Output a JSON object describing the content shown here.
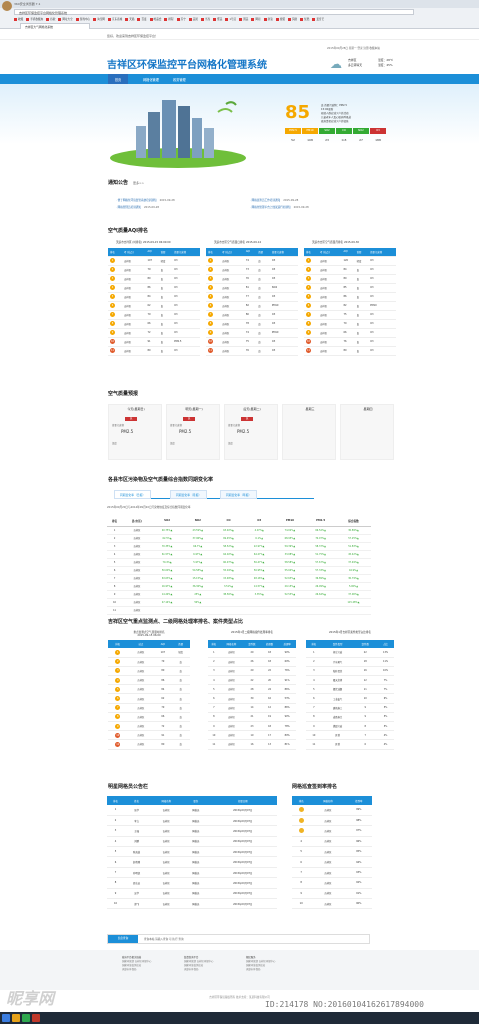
{
  "browser": {
    "window_title": "360安全浏览器 7.1",
    "address": "吉祥区环保监控平台网格化管理系统",
    "tab": "吉祥区大气网格化系统",
    "favs": [
      "收藏",
      "手机收藏夹",
      "谷歌",
      "网址大全",
      "游戏中心",
      "淘宝网",
      "京东商城",
      "天猫",
      "百度",
      "唯品会",
      "携程",
      "苏宁",
      "美团",
      "当当",
      "聚美",
      "1号店",
      "国美",
      "网易",
      "新浪",
      "搜狐",
      "凤凰",
      "优酷",
      "爱奇艺"
    ]
  },
  "site": {
    "topbar": "您好，欢迎来到吉祥区环保监控平台！",
    "logo": "吉祥区环保监控平台网格化管理系统",
    "toplinks": "2015年09月28日 星期一  登录  注册  收藏本站",
    "weather": {
      "city": "吉祥区",
      "desc": "多云转晴天",
      "wind": "东北风3级",
      "temp_label": "温度：",
      "temp": "28℃",
      "hum_label": "湿度：",
      "hum": "45%"
    },
    "nav": [
      "首页",
      "网格化管理",
      "政务管理"
    ],
    "aqi": {
      "value": "85",
      "level": "良 首要污染物：PM2.5",
      "time": "15:00更新",
      "line1": "易感人群应减少户外活动",
      "line2": "儿童老年人及心脏病呼吸道",
      "line3": "疾病患者应减少户外锻炼",
      "pollutants": [
        "PM2.5",
        "PM10",
        "SO2",
        "CO",
        "NO2",
        "O3"
      ],
      "values": [
        "52",
        "108",
        "23",
        "0.8",
        "27",
        "188"
      ],
      "colors": [
        "#f5a800",
        "#f5a800",
        "#3a3",
        "#3a3",
        "#3a3",
        "#c33"
      ]
    }
  },
  "notices": {
    "title": "通知公告",
    "more": "更多>>",
    "items": [
      {
        "t": "便于网格化环境监管系统培训通知",
        "d": "2015-09-28"
      },
      {
        "t": "网格巡查员工作培训通知",
        "d": "2015-09-28"
      },
      {
        "t": "网格管理员培训通知",
        "d": "2015-09-28"
      },
      {
        "t": "网格化管理平台上线试运行的通知",
        "d": "2015-09-28"
      }
    ]
  },
  "aqi_rank": {
    "title": "空气质量AQI排名",
    "tables": [
      {
        "caption": "天庭市吉祥区 (时排名) 2015-09-15 06:00:00",
        "head": [
          "排名",
          "考 (站点)",
          "AQI",
          "首要",
          "首要污染物"
        ],
        "rows": [
          [
            "1",
            "吉祥区",
            "107",
            "轻度",
            "O3"
          ],
          [
            "2",
            "吉祥区",
            "79",
            "良",
            "O3"
          ],
          [
            "3",
            "吉祥区",
            "80",
            "良",
            "O3"
          ],
          [
            "4",
            "吉祥区",
            "86",
            "良",
            "O3"
          ],
          [
            "5",
            "吉祥区",
            "84",
            "良",
            "O3"
          ],
          [
            "6",
            "吉祥区",
            "62",
            "良",
            "O3"
          ],
          [
            "7",
            "吉祥区",
            "79",
            "良",
            "O3"
          ],
          [
            "8",
            "吉祥区",
            "66",
            "良",
            "O3"
          ],
          [
            "9",
            "吉祥区",
            "72",
            "良",
            "O3"
          ],
          [
            "10",
            "吉祥区",
            "91",
            "良",
            "PM2.5"
          ],
          [
            "11",
            "吉祥区",
            "80",
            "良",
            "O3"
          ]
        ]
      },
      {
        "caption": "天庭市吉区空气质量日排名 2015-09-14",
        "head": [
          "排名",
          "考 (站点)",
          "AQI",
          "首要",
          "首要污染物"
        ],
        "rows": [
          [
            "1",
            "吉祥区",
            "74",
            "良",
            "O3"
          ],
          [
            "2",
            "吉祥区",
            "73",
            "良",
            "O3"
          ],
          [
            "3",
            "吉祥区",
            "76",
            "良",
            "O3"
          ],
          [
            "4",
            "吉祥区",
            "81",
            "良",
            "NO2"
          ],
          [
            "5",
            "吉祥区",
            "77",
            "良",
            "O3"
          ],
          [
            "6",
            "吉祥区",
            "82",
            "良",
            "PM10"
          ],
          [
            "7",
            "吉祥区",
            "80",
            "良",
            "O3"
          ],
          [
            "8",
            "吉祥区",
            "78",
            "良",
            "O3"
          ],
          [
            "9",
            "吉祥区",
            "74",
            "良",
            "PM10"
          ],
          [
            "10",
            "吉祥区",
            "75",
            "良",
            "O3"
          ],
          [
            "11",
            "吉祥区",
            "76",
            "良",
            "O3"
          ]
        ]
      },
      {
        "caption": "天庭市吉区空气质量月排名 2015-09-30",
        "head": [
          "排名",
          "考 (站点)",
          "AQI",
          "首要",
          "首要污染物"
        ],
        "rows": [
          [
            "1",
            "吉祥区",
            "120",
            "轻度",
            "O3"
          ],
          [
            "2",
            "吉祥区",
            "84",
            "良",
            "O3"
          ],
          [
            "3",
            "吉祥区",
            "80",
            "良",
            "O3"
          ],
          [
            "4",
            "吉祥区",
            "85",
            "良",
            "O3"
          ],
          [
            "5",
            "吉祥区",
            "86",
            "良",
            "O3"
          ],
          [
            "6",
            "吉祥区",
            "82",
            "良",
            "PM10"
          ],
          [
            "7",
            "吉祥区",
            "75",
            "良",
            "O3"
          ],
          [
            "8",
            "吉祥区",
            "70",
            "良",
            "O3"
          ],
          [
            "9",
            "吉祥区",
            "66",
            "良",
            "O3"
          ],
          [
            "10",
            "吉祥区",
            "76",
            "良",
            "O3"
          ],
          [
            "11",
            "吉祥区",
            "80",
            "良",
            "O3"
          ]
        ]
      }
    ]
  },
  "forecast": {
    "title": "空气质量预报",
    "days": [
      {
        "h": "今天(星期日)",
        "tag": "良"
      },
      {
        "h": "明天(星期一)",
        "tag": "良"
      },
      {
        "h": "后天(星期二)",
        "tag": "良"
      },
      {
        "h": "星期三",
        "tag": ""
      },
      {
        "h": "星期四",
        "tag": ""
      }
    ],
    "pm_label": "PM2.5",
    "lbl_primary": "首要污染物",
    "lbl_temp": "温度"
  },
  "index_change": {
    "title": "各县市区污染物及空气质量综合指数同期变化率",
    "tabs": [
      "同期变化率（日报）",
      "同期变化率（月报）",
      "同期变化率（年报）"
    ],
    "note": "2015年09月20日与2014年09月20日污染物浓度及综合指数同期变化率",
    "head": [
      "排名",
      "县(市区)",
      "SO2",
      "NO2",
      "CO",
      "O3",
      "PM10",
      "PM2.5",
      "综合指数"
    ],
    "rows": [
      [
        "1",
        "吉祥区",
        "40.75%▲",
        "43.59%▲",
        "63.92%▲",
        "4.07%▲",
        "74.02%▲",
        "66.52%▲",
        "30.89%▲"
      ],
      [
        "2",
        "吉祥区",
        "62.5%▲",
        "37.96%▲",
        "69.45%▲",
        "6.1%▲",
        "68.95%▲",
        "70.07%▲",
        "57.25%▲"
      ],
      [
        "3",
        "吉祥区",
        "70.35%▲",
        "66.7%▲",
        "58.52%▲",
        "22.97%▲",
        "59.39%▲",
        "58.37%▲",
        "51.83%▲"
      ],
      [
        "4",
        "吉祥区",
        "61.57%▲",
        "6.97%▲",
        "64.02%▲",
        "64.27%▲",
        "33.08%▲",
        "51.75%▲",
        "45.42%▲"
      ],
      [
        "5",
        "吉祥区",
        "70.4%▲",
        "5.97%▲",
        "60.97%▲",
        "56.47%▲",
        "58.58%▲",
        "57.67%▲",
        "37.49%▲"
      ],
      [
        "6",
        "吉祥区",
        "50.00%▲",
        "54.58%▲",
        "55.04%▲",
        "56.95%▲",
        "55.04%▲",
        "57.33%▲",
        "44.9%▲"
      ],
      [
        "7",
        "吉祥区",
        "63.03%▲",
        "15.15%▲",
        "15.48%▲",
        "48.16%▲",
        "52.63%▲",
        "36.89%▲",
        "30.79%▲"
      ],
      [
        "8",
        "吉祥区",
        "16.97%▲",
        "36.36%▲",
        "3.51%▲",
        "14.57%▲",
        "20.15%▲",
        "26.09%▲",
        "5.00%▲"
      ],
      [
        "9",
        "吉祥区",
        "14.29%▲",
        "25%▲",
        "38.56%▲",
        "3.35%▲",
        "52.53%▲",
        "26.64%▲",
        "37.00%▲"
      ],
      [
        "10",
        "吉祥区",
        "47.14%▲",
        "50%▲",
        "",
        "",
        "",
        "",
        "115.28%▲"
      ],
      [
        "11",
        "吉祥区",
        "",
        "",
        "",
        "",
        "",
        "",
        ""
      ]
    ]
  },
  "monitor": {
    "title": "吉祥区空气重点监测点、二级网格处理率排名、案件类型占比",
    "t1": {
      "caption": "重点监测点空气质量时排名",
      "sub": "2015-09-15 06:00",
      "head": [
        "排名",
        "站点",
        "AQI",
        "首要"
      ],
      "rows": [
        [
          "1",
          "吉祥区",
          "107",
          "轻度"
        ],
        [
          "2",
          "吉祥区",
          "79",
          "良"
        ],
        [
          "3",
          "吉祥区",
          "80",
          "良"
        ],
        [
          "4",
          "吉祥区",
          "86",
          "良"
        ],
        [
          "5",
          "吉祥区",
          "84",
          "良"
        ],
        [
          "6",
          "吉祥区",
          "62",
          "良"
        ],
        [
          "7",
          "吉祥区",
          "79",
          "良"
        ],
        [
          "8",
          "吉祥区",
          "66",
          "良"
        ],
        [
          "9",
          "吉祥区",
          "72",
          "良"
        ],
        [
          "10",
          "吉祥区",
          "91",
          "良"
        ],
        [
          "11",
          "吉祥区",
          "80",
          "良"
        ]
      ]
    },
    "t2": {
      "caption": "2015年1月二级网格案件处理率排名",
      "head": [
        "排名",
        "网格名称",
        "案件数",
        "处理数",
        "处理率"
      ],
      "rows": [
        [
          "1",
          "吉祥区",
          "20",
          "18",
          "90%"
        ],
        [
          "2",
          "吉祥区",
          "26",
          "18",
          "69%"
        ],
        [
          "3",
          "吉祥区",
          "29",
          "22",
          "76%"
        ],
        [
          "4",
          "吉祥区",
          "22",
          "20",
          "91%"
        ],
        [
          "5",
          "吉祥区",
          "28",
          "24",
          "86%"
        ],
        [
          "6",
          "吉祥区",
          "30",
          "16",
          "53%"
        ],
        [
          "7",
          "吉祥区",
          "14",
          "12",
          "86%"
        ],
        [
          "8",
          "吉祥区",
          "21",
          "19",
          "90%"
        ],
        [
          "9",
          "吉祥区",
          "23",
          "18",
          "78%"
        ],
        [
          "10",
          "吉祥区",
          "19",
          "17",
          "89%"
        ],
        [
          "11",
          "吉祥区",
          "16",
          "13",
          "81%"
        ]
      ]
    },
    "t3": {
      "caption": "2015年1月吉祥区案件类型占比排名",
      "head": [
        "排名",
        "案件类型",
        "案件数",
        "占比"
      ],
      "rows": [
        [
          "1",
          "扬尘污染",
          "22",
          "13%"
        ],
        [
          "2",
          "汽车尾气",
          "18",
          "11%"
        ],
        [
          "3",
          "秸秆焚烧",
          "16",
          "10%"
        ],
        [
          "4",
          "露天烧烤",
          "12",
          "7%"
        ],
        [
          "5",
          "餐饮油烟",
          "11",
          "7%"
        ],
        [
          "6",
          "工业废气",
          "10",
          "6%"
        ],
        [
          "7",
          "建筑施工",
          "9",
          "5%"
        ],
        [
          "8",
          "道路扬尘",
          "9",
          "5%"
        ],
        [
          "9",
          "燃煤污染",
          "8",
          "5%"
        ],
        [
          "10",
          "其他",
          "7",
          "4%"
        ],
        [
          "11",
          "其他",
          "6",
          "4%"
        ]
      ]
    }
  },
  "members": {
    "title": "明星网格员公告栏",
    "head": [
      "排名",
      "姓名",
      "网格名称",
      "职务",
      "任职日期"
    ],
    "rows": [
      [
        "1",
        "张华",
        "吉祥区",
        "网格员",
        "2015年09月07日"
      ],
      [
        "2",
        "李立",
        "吉祥区",
        "网格员",
        "2015年09月07日"
      ],
      [
        "3",
        "王强",
        "吉祥区",
        "网格员",
        "2015年09月07日"
      ],
      [
        "4",
        "刘鹏",
        "吉祥区",
        "网格员",
        "2015年09月07日"
      ],
      [
        "5",
        "陈海波",
        "吉祥区",
        "网格员",
        "2015年09月07日"
      ],
      [
        "6",
        "赵晓刚",
        "吉祥区",
        "网格员",
        "2015年09月07日"
      ],
      [
        "7",
        "孙明凯",
        "吉祥区",
        "网格员",
        "2015年09月07日"
      ],
      [
        "8",
        "周志远",
        "吉祥区",
        "网格员",
        "2015年09月07日"
      ],
      [
        "9",
        "吴华",
        "吉祥区",
        "网格员",
        "2015年09月07日"
      ],
      [
        "10",
        "郑飞",
        "吉祥区",
        "网格员",
        "2015年09月07日"
      ]
    ]
  },
  "patrol": {
    "title": "网格巡查签到率排名",
    "head": [
      "排名",
      "网格名称",
      "签到率"
    ],
    "rows": [
      [
        "1",
        "吉祥区",
        "99%"
      ],
      [
        "2",
        "吉祥区",
        "98%"
      ],
      [
        "3",
        "吉祥区",
        "97%"
      ],
      [
        "4",
        "吉祥区",
        "96%"
      ],
      [
        "5",
        "吉祥区",
        "95%"
      ],
      [
        "6",
        "吉祥区",
        "94%"
      ],
      [
        "7",
        "吉祥区",
        "93%"
      ],
      [
        "8",
        "吉祥区",
        "92%"
      ],
      [
        "9",
        "吉祥区",
        "91%"
      ],
      [
        "10",
        "吉祥区",
        "90%"
      ]
    ]
  },
  "search": {
    "btn": "信息查询",
    "placeholder": "查询本站 请输入查询 可 执行 查询"
  },
  "footer": {
    "cols": [
      {
        "h": "政府平台相关链接",
        "items": [
          "国家环保部 吉祥区环保中心",
          "国家环境监测总站",
          "天庭市环保局"
        ]
      },
      {
        "h": "监督查询平台",
        "items": [
          "国家环保部 吉祥区环保中心",
          "国家环境监测总站",
          "天庭市环保局"
        ]
      },
      {
        "h": "便民服务",
        "items": [
          "国家环保部 吉祥区环保中心",
          "国家环境监测总站",
          "天庭市环保局"
        ]
      }
    ],
    "copyright": "吉祥区环保局版权所有 技术支持：某某科技有限公司"
  },
  "watermark": {
    "site": "昵享网 www.nipic.com",
    "id": "ID:214178 NO:20160104162617894000"
  }
}
